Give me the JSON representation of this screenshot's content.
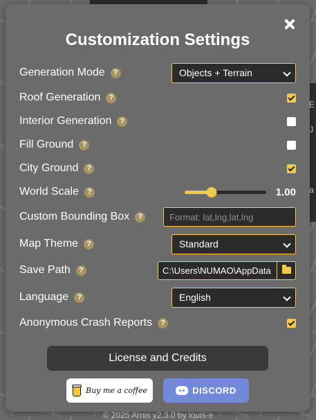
{
  "background": {
    "footer_text": "© 2025 Arnis v2.3.0 by louis-e",
    "right_edge_chars": [
      "E",
      "J",
      "a"
    ]
  },
  "modal": {
    "title": "Customization Settings",
    "close_icon": "close-icon",
    "settings": {
      "generation_mode": {
        "label": "Generation Mode",
        "value": "Objects + Terrain"
      },
      "roof_generation": {
        "label": "Roof Generation",
        "checked": true
      },
      "interior_generation": {
        "label": "Interior Generation",
        "checked": false
      },
      "fill_ground": {
        "label": "Fill Ground",
        "checked": false
      },
      "city_ground": {
        "label": "City Ground",
        "checked": true
      },
      "world_scale": {
        "label": "World Scale",
        "value": "1.00",
        "slider_fraction": 0.33
      },
      "custom_bbox": {
        "label": "Custom Bounding Box",
        "placeholder": "Format: lat,lng,lat,lng"
      },
      "map_theme": {
        "label": "Map Theme",
        "value": "Standard"
      },
      "save_path": {
        "label": "Save Path",
        "value": "C:\\Users\\NUMAO\\AppData"
      },
      "language": {
        "label": "Language",
        "value": "English"
      },
      "crash_reports": {
        "label": "Anonymous Crash Reports",
        "checked": true
      }
    },
    "help_glyph": "?",
    "license_button": "License and Credits",
    "coffee_button": "Buy me a coffee",
    "discord_button": "DISCORD"
  },
  "colors": {
    "accent": "#f2c94c",
    "panel": "#6b6b6b",
    "field": "#2b2b2b",
    "help_badge": "#a79561",
    "discord": "#7289da"
  }
}
